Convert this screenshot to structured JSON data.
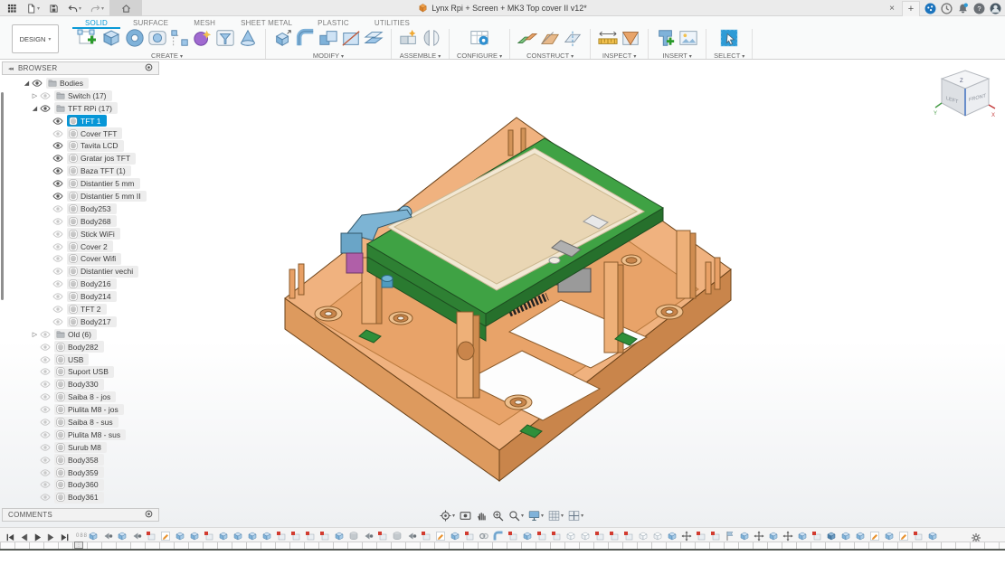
{
  "titlebar": {
    "title": "Lynx Rpi + Screen + MK3 Top cover II v12*",
    "close_label": "×",
    "new_tab_label": "+",
    "left_icons": [
      "app-grid",
      "file",
      "save",
      "undo",
      "redo"
    ],
    "home_tab_icon": "home",
    "document_icon": "orange-cube",
    "right_icons": [
      "extensions",
      "job-status",
      "notifications",
      "help",
      "account"
    ]
  },
  "ribbon": {
    "design_label": "DESIGN",
    "tabs": [
      {
        "label": "SOLID",
        "active": true
      },
      {
        "label": "SURFACE",
        "active": false
      },
      {
        "label": "MESH",
        "active": false
      },
      {
        "label": "SHEET METAL",
        "active": false
      },
      {
        "label": "PLASTIC",
        "active": false
      },
      {
        "label": "UTILITIES",
        "active": false
      }
    ],
    "groups": [
      {
        "label": "CREATE",
        "icons": [
          "create-sketch",
          "extrude",
          "revolve",
          "sweep",
          "pattern",
          "form",
          "thicken",
          "cone"
        ]
      },
      {
        "label": "MODIFY",
        "icons": [
          "press-pull",
          "fillet",
          "combine",
          "split",
          "offset-plane"
        ]
      },
      {
        "label": "ASSEMBLE",
        "icons": [
          "new-component",
          "joint"
        ]
      },
      {
        "label": "CONFIGURE",
        "icons": [
          "configuration"
        ]
      },
      {
        "label": "CONSTRUCT",
        "icons": [
          "plane-pair",
          "plane-angle",
          "axis-plane"
        ]
      },
      {
        "label": "INSPECT",
        "icons": [
          "measure",
          "section"
        ]
      },
      {
        "label": "INSERT",
        "icons": [
          "insert-derive",
          "canvas"
        ]
      },
      {
        "label": "SELECT",
        "icons": [
          "select-box"
        ]
      }
    ]
  },
  "browser": {
    "header": "BROWSER",
    "tree": [
      {
        "label": "Bodies",
        "level": 1,
        "type": "folder",
        "eye": "on",
        "caret": "open",
        "selected": false
      },
      {
        "label": "Switch (17)",
        "level": 2,
        "type": "folder",
        "eye": "off",
        "caret": "closed",
        "selected": false
      },
      {
        "label": "TFT RPi (17)",
        "level": 2,
        "type": "folder",
        "eye": "on",
        "caret": "open",
        "selected": false
      },
      {
        "label": "TFT 1",
        "level": 3,
        "type": "body",
        "eye": "on",
        "caret": "none",
        "selected": true
      },
      {
        "label": "Cover TFT",
        "level": 3,
        "type": "body",
        "eye": "off",
        "caret": "none",
        "selected": false
      },
      {
        "label": "Tavita LCD",
        "level": 3,
        "type": "body",
        "eye": "on",
        "caret": "none",
        "selected": false
      },
      {
        "label": "Gratar jos TFT",
        "level": 3,
        "type": "body",
        "eye": "on",
        "caret": "none",
        "selected": false
      },
      {
        "label": "Baza TFT (1)",
        "level": 3,
        "type": "body",
        "eye": "on",
        "caret": "none",
        "selected": false
      },
      {
        "label": "Distantier 5 mm",
        "level": 3,
        "type": "body",
        "eye": "on",
        "caret": "none",
        "selected": false
      },
      {
        "label": "Distantier 5 mm II",
        "level": 3,
        "type": "body",
        "eye": "on",
        "caret": "none",
        "selected": false
      },
      {
        "label": "Body253",
        "level": 3,
        "type": "body",
        "eye": "off",
        "caret": "none",
        "selected": false
      },
      {
        "label": "Body268",
        "level": 3,
        "type": "body",
        "eye": "off",
        "caret": "none",
        "selected": false
      },
      {
        "label": "Stick WiFi",
        "level": 3,
        "type": "body",
        "eye": "off",
        "caret": "none",
        "selected": false
      },
      {
        "label": "Cover 2",
        "level": 3,
        "type": "body",
        "eye": "off",
        "caret": "none",
        "selected": false
      },
      {
        "label": "Cover Wifi",
        "level": 3,
        "type": "body",
        "eye": "off",
        "caret": "none",
        "selected": false
      },
      {
        "label": "Distantier vechi",
        "level": 3,
        "type": "body",
        "eye": "off",
        "caret": "none",
        "selected": false
      },
      {
        "label": "Body216",
        "level": 3,
        "type": "body",
        "eye": "off",
        "caret": "none",
        "selected": false
      },
      {
        "label": "Body214",
        "level": 3,
        "type": "body",
        "eye": "off",
        "caret": "none",
        "selected": false
      },
      {
        "label": "TFT 2",
        "level": 3,
        "type": "body",
        "eye": "off",
        "caret": "none",
        "selected": false
      },
      {
        "label": "Body217",
        "level": 3,
        "type": "body",
        "eye": "off",
        "caret": "none",
        "selected": false
      },
      {
        "label": "Old (6)",
        "level": 2,
        "type": "folder",
        "eye": "off",
        "caret": "closed",
        "selected": false
      },
      {
        "label": "Body282",
        "level": 2,
        "type": "body",
        "eye": "off",
        "caret": "none",
        "selected": false
      },
      {
        "label": "USB",
        "level": 2,
        "type": "body",
        "eye": "off",
        "caret": "none",
        "selected": false
      },
      {
        "label": "Suport USB",
        "level": 2,
        "type": "body",
        "eye": "off",
        "caret": "none",
        "selected": false
      },
      {
        "label": "Body330",
        "level": 2,
        "type": "body",
        "eye": "off",
        "caret": "none",
        "selected": false
      },
      {
        "label": "Saiba 8 - jos",
        "level": 2,
        "type": "body",
        "eye": "off",
        "caret": "none",
        "selected": false
      },
      {
        "label": "Piulita M8 - jos",
        "level": 2,
        "type": "body",
        "eye": "off",
        "caret": "none",
        "selected": false
      },
      {
        "label": "Saiba 8 - sus",
        "level": 2,
        "type": "body",
        "eye": "off",
        "caret": "none",
        "selected": false
      },
      {
        "label": "Piulita M8 - sus",
        "level": 2,
        "type": "body",
        "eye": "off",
        "caret": "none",
        "selected": false
      },
      {
        "label": "Surub M8",
        "level": 2,
        "type": "body",
        "eye": "off",
        "caret": "none",
        "selected": false
      },
      {
        "label": "Body358",
        "level": 2,
        "type": "body",
        "eye": "off",
        "caret": "none",
        "selected": false
      },
      {
        "label": "Body359",
        "level": 2,
        "type": "body",
        "eye": "off",
        "caret": "none",
        "selected": false
      },
      {
        "label": "Body360",
        "level": 2,
        "type": "body",
        "eye": "off",
        "caret": "none",
        "selected": false
      },
      {
        "label": "Body361",
        "level": 2,
        "type": "body",
        "eye": "off",
        "caret": "none",
        "selected": false
      }
    ]
  },
  "comments": {
    "header": "COMMENTS"
  },
  "viewcube": {
    "left_face": "LEFT",
    "right_face": "FRONT",
    "axis_x": "X",
    "axis_y": "Y",
    "axis_z": "Z"
  },
  "navbar": [
    {
      "name": "orbit",
      "caret": true
    },
    {
      "name": "look-at",
      "caret": false
    },
    {
      "name": "pan",
      "caret": false
    },
    {
      "name": "zoom",
      "caret": false
    },
    {
      "name": "fit",
      "caret": true
    },
    {
      "name": "display-settings",
      "caret": true
    },
    {
      "name": "grid-settings",
      "caret": true
    },
    {
      "name": "viewports",
      "caret": true
    }
  ],
  "timeline": {
    "position_label": "088",
    "playback": [
      "go-to-start",
      "step-back",
      "play",
      "step-forward",
      "go-to-end"
    ],
    "features": [
      "ext",
      "arrow",
      "ext",
      "arrow",
      "red",
      "sketch",
      "ext",
      "ext",
      "red",
      "ext",
      "ext",
      "ext",
      "ext",
      "red",
      "red",
      "red",
      "red",
      "ext",
      "gray",
      "arrow",
      "red",
      "gray",
      "arrow",
      "red",
      "sketch",
      "ext",
      "red",
      "link",
      "fillet-feat",
      "red",
      "ext",
      "red",
      "red",
      "outline",
      "outline",
      "red",
      "red",
      "red",
      "outline",
      "outline",
      "ext",
      "move",
      "red",
      "red",
      "flag",
      "ext",
      "move",
      "ext",
      "move",
      "ext",
      "red",
      "ext2",
      "ext",
      "ext",
      "sketch",
      "ext",
      "sketch",
      "red",
      "ext"
    ],
    "settings_icon": "gear"
  },
  "model": {
    "parts": [
      {
        "name": "case-bottom",
        "color": "#EDA76E"
      },
      {
        "name": "pcb-board",
        "color": "#3FA244"
      },
      {
        "name": "tft-screen",
        "color": "#E9D6B4"
      },
      {
        "name": "heatsink-bracket",
        "color": "#7DB4D4"
      },
      {
        "name": "standoff-pins",
        "color": "#D29358"
      },
      {
        "name": "nut-block",
        "color": "#B05FA8"
      },
      {
        "name": "connector",
        "color": "#9A9A9A"
      }
    ]
  },
  "colors": {
    "accent_blue": "#0696D7",
    "selection": "#0696D7",
    "ribbon_bg": "#F9FAFA",
    "titlebar_bg": "#EBEBEB"
  }
}
